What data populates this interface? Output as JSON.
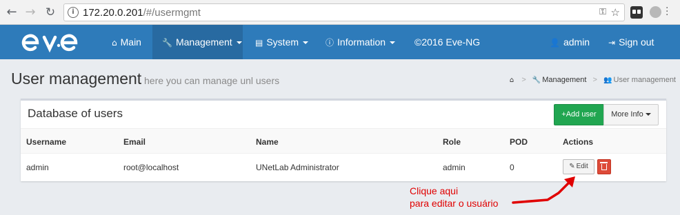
{
  "browser": {
    "url_host": "172.20.0.201",
    "url_path": "/#/usermgmt"
  },
  "navbar": {
    "logo_alt": "eve",
    "items": [
      {
        "label": "Main",
        "icon": "home-icon"
      },
      {
        "label": "Management",
        "icon": "wrench-icon",
        "active": true
      },
      {
        "label": "System",
        "icon": "book-icon"
      },
      {
        "label": "Information",
        "icon": "info-icon"
      },
      {
        "label": "©2016 Eve-NG"
      }
    ],
    "user": "admin",
    "signout": "Sign out"
  },
  "page": {
    "title": "User management",
    "subtitle": "here you can manage unl users"
  },
  "breadcrumb": {
    "section": "Management",
    "current": "User management"
  },
  "panel": {
    "title": "Database of users",
    "add_button": "+Add user",
    "more_button": "More Info"
  },
  "table": {
    "headers": [
      "Username",
      "Email",
      "Name",
      "Role",
      "POD",
      "Actions"
    ],
    "rows": [
      {
        "username": "admin",
        "email": "root@localhost",
        "name": "UNetLab Administrator",
        "role": "admin",
        "pod": "0",
        "edit": "Edit"
      }
    ]
  },
  "annotation": {
    "line1": "Clique aqui",
    "line2": "para editar o usuário",
    "color": "#e00000"
  },
  "colors": {
    "navbar": "#2e7bba",
    "add_button": "#21a651",
    "delete_button": "#dd4b39"
  }
}
